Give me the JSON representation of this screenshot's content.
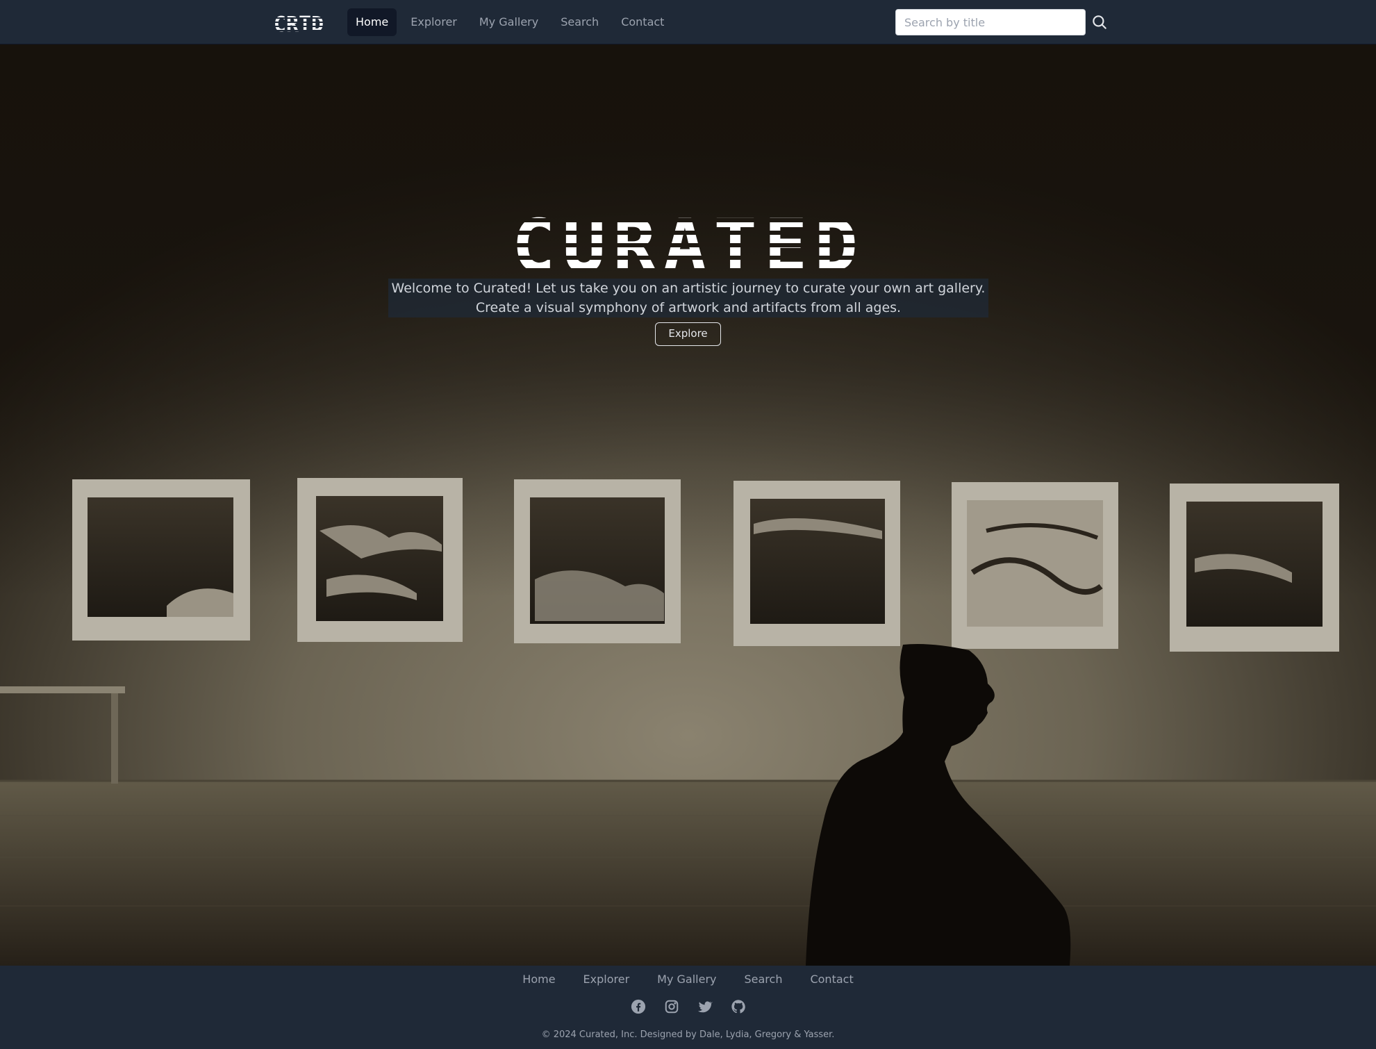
{
  "nav": {
    "brand": "CRTD",
    "links": [
      {
        "label": "Home",
        "active": true
      },
      {
        "label": "Explorer",
        "active": false
      },
      {
        "label": "My Gallery",
        "active": false
      },
      {
        "label": "Search",
        "active": false
      },
      {
        "label": "Contact",
        "active": false
      }
    ],
    "search": {
      "placeholder": "Search by title",
      "value": "",
      "icon": "search-icon"
    }
  },
  "hero": {
    "title": "CURATED",
    "description_line1": "Welcome to Curated! Let us take you on an artistic journey to curate your own art gallery.",
    "description_line2": "Create a visual symphony of artwork and artifacts from all ages.",
    "button_label": "Explore",
    "background": "dimmed photo of an art gallery wall with six framed ink landscape paintings and a silhouetted seated visitor"
  },
  "footer": {
    "links": [
      "Home",
      "Explorer",
      "My Gallery",
      "Search",
      "Contact"
    ],
    "social": [
      "facebook-icon",
      "instagram-icon",
      "twitter-icon",
      "github-icon"
    ],
    "copyright": "© 2024 Curated, Inc. Designed by Dale, Lydia, Gregory & Yasser."
  },
  "colors": {
    "nav_bg": "#1f2937",
    "active_link_bg": "#111827",
    "text_muted": "#9ca3af",
    "white": "#ffffff"
  }
}
